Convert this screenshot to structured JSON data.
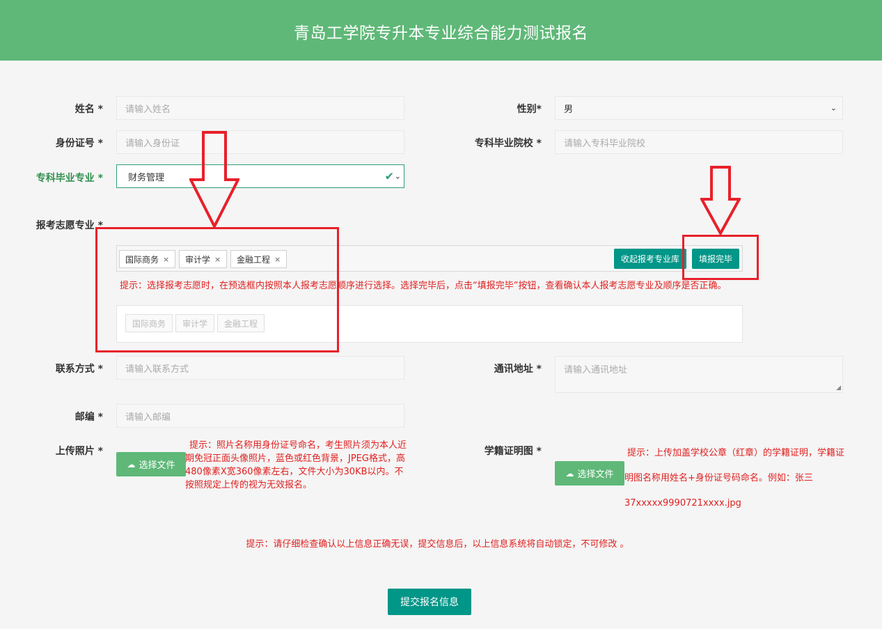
{
  "header": {
    "title": "青岛工学院专升本专业综合能力测试报名"
  },
  "form": {
    "name": {
      "label": "姓名 *",
      "placeholder": "请输入姓名"
    },
    "gender": {
      "label": "性别*",
      "value": "男"
    },
    "id_card": {
      "label": "身份证号 *",
      "placeholder": "请输入身份证"
    },
    "college": {
      "label": "专科毕业院校 *",
      "placeholder": "请输入专科毕业院校"
    },
    "college_major": {
      "label": "专科毕业专业 *",
      "value": "财务管理"
    },
    "wish_major": {
      "label": "报考志愿专业 *",
      "tags": [
        "国际商务",
        "审计学",
        "金融工程"
      ],
      "tag_remove": "×",
      "collapse_button": "收起报考专业库",
      "done_button": "填报完毕",
      "hint": "提示：选择报考志愿时，在预选框内按照本人报考志愿顺序进行选择。选择完毕后，点击“填报完毕”按钮，查看确认本人报考志愿专业及顺序是否正确。",
      "preview_tags": [
        "国际商务",
        "审计学",
        "金融工程"
      ]
    },
    "contact": {
      "label": "联系方式 *",
      "placeholder": "请输入联系方式"
    },
    "address": {
      "label": "通讯地址 *",
      "placeholder": "请输入通讯地址"
    },
    "postcode": {
      "label": "邮编 *",
      "placeholder": "请输入邮编"
    },
    "photo": {
      "label": "上传照片 *",
      "button": "选择文件",
      "hint": "提示：照片名称用身份证号命名，考生照片须为本人近期免冠正面头像照片，蓝色或红色背景，JPEG格式，高480像素X宽360像素左右，文件大小为30KB以内。不按照规定上传的视为无效报名。"
    },
    "student_cert": {
      "label": "学籍证明图 *",
      "button": "选择文件",
      "hint": "提示：上传加盖学校公章（红章）的学籍证明，学籍证明图名称用姓名+身份证号码命名。例如：张三37xxxxx9990721xxxx.jpg"
    },
    "final_hint": "提示：请仔细检查确认以上信息正确无误，提交信息后，以上信息系统将自动锁定，不可修改 。",
    "submit_button": "提交报名信息"
  },
  "colors": {
    "header": "#5fb878",
    "teal": "#009688",
    "hint_red": "#e02020",
    "annotation_red": "#e8202a"
  }
}
